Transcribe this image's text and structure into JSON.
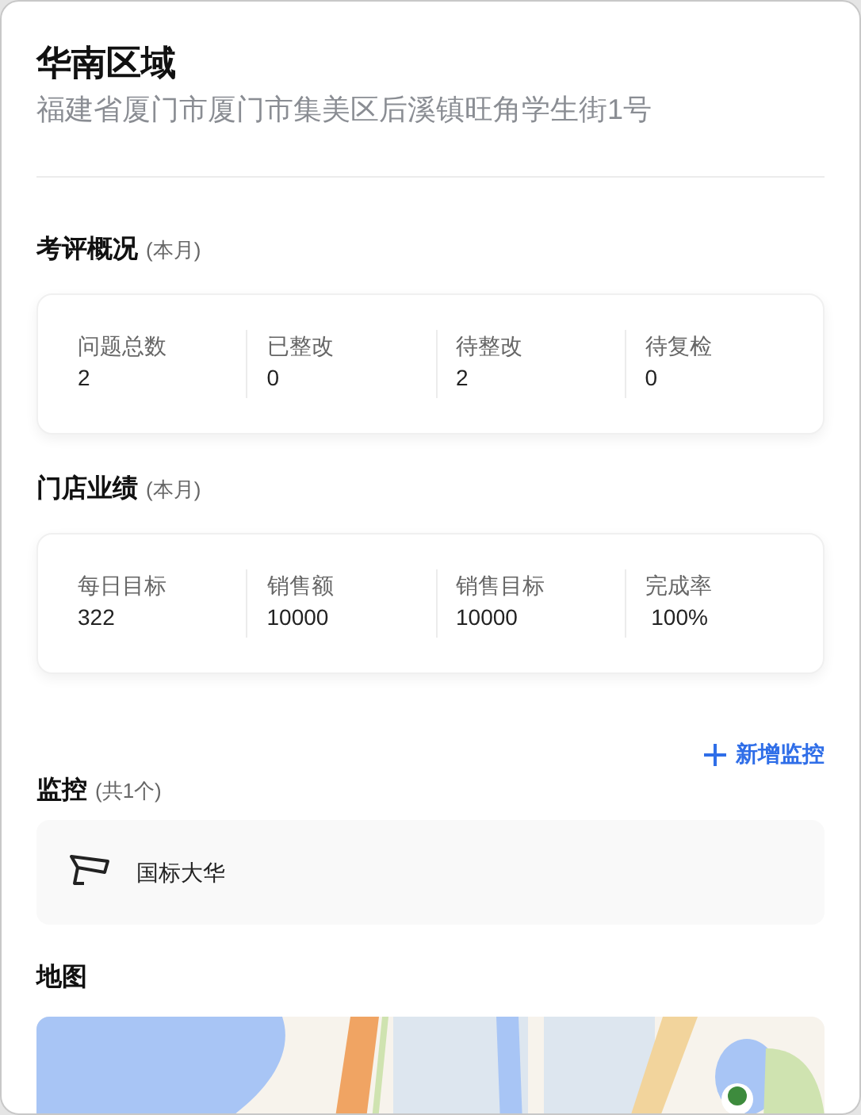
{
  "header": {
    "title": "华南区域",
    "address": "福建省厦门市厦门市集美区后溪镇旺角学生街1号"
  },
  "evaluation": {
    "title": "考评概况",
    "note": "(本月)",
    "stats": [
      {
        "label": "问题总数",
        "value": "2"
      },
      {
        "label": "已整改",
        "value": "0"
      },
      {
        "label": "待整改",
        "value": "2"
      },
      {
        "label": "待复检",
        "value": "0"
      }
    ]
  },
  "performance": {
    "title": "门店业绩",
    "note": "(本月)",
    "stats": [
      {
        "label": "每日目标",
        "value": "322"
      },
      {
        "label": "销售额",
        "value": "10000"
      },
      {
        "label": "销售目标",
        "value": "10000"
      },
      {
        "label": "完成率",
        "value": " 100%"
      }
    ]
  },
  "monitoring": {
    "add_button": "新增监控",
    "title": "监控",
    "note": "(共1个)",
    "cameras": [
      {
        "name": "国标大华"
      }
    ]
  },
  "map": {
    "title": "地图",
    "kind": "picture"
  }
}
